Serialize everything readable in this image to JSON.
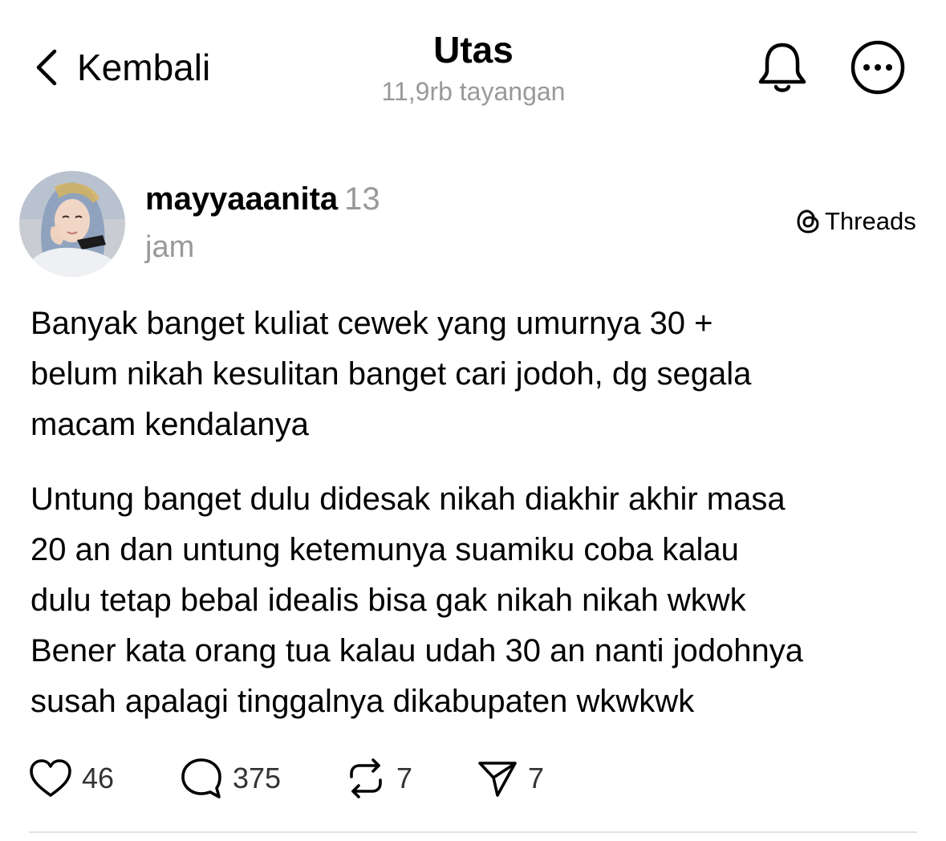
{
  "header": {
    "back_label": "Kembali",
    "title": "Utas",
    "views": "11,9rb tayangan",
    "icons": [
      "chevron-left-icon",
      "bell-icon",
      "more-icon"
    ]
  },
  "post": {
    "username": "mayyaaanita",
    "time_num": "13",
    "time_unit": "jam",
    "badge": "Threads",
    "paragraphs": [
      "Banyak banget kuliat cewek yang umurnya 30 +\nbelum nikah kesulitan banget cari jodoh, dg segala\nmacam kendalanya",
      "Untung banget dulu didesak nikah diakhir akhir masa\n20 an dan untung ketemunya suamiku coba kalau\ndulu tetap bebal idealis bisa gak nikah nikah wkwk\nBener kata orang tua kalau udah 30 an nanti jodohnya\nsusah apalagi tinggalnya dikabupaten wkwkwk"
    ]
  },
  "actions": {
    "likes": "46",
    "replies": "375",
    "reposts": "7",
    "shares": "7"
  },
  "colors": {
    "text": "#000000",
    "muted": "#999999",
    "divider": "#e2e2e2"
  }
}
